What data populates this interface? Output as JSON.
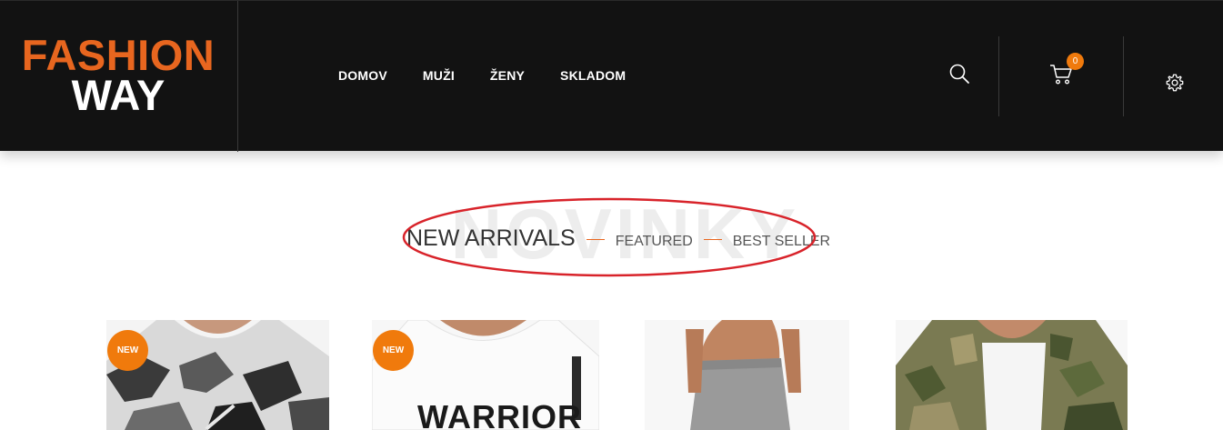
{
  "colors": {
    "accent": "#e8661f",
    "header_bg": "#121212",
    "annotation": "#d8232a",
    "badge": "#f07a0c"
  },
  "logo": {
    "line1": "FASHION",
    "line2": "WAY"
  },
  "nav": {
    "items": [
      "DOMOV",
      "MUŽI",
      "ŽENY",
      "SKLADOM"
    ]
  },
  "header_icons": {
    "search": "search-icon",
    "cart": "cart-icon",
    "settings": "gear-icon"
  },
  "cart": {
    "count": "0"
  },
  "section": {
    "ghost_title": "NOVINKY",
    "tabs": [
      {
        "label": "NEW ARRIVALS",
        "active": true
      },
      {
        "label": "FEATURED",
        "active": false
      },
      {
        "label": "BEST SELLER",
        "active": false
      }
    ]
  },
  "products": [
    {
      "badge": "NEW",
      "print": ""
    },
    {
      "badge": "NEW",
      "print": "WARRIOR"
    },
    {
      "badge": "",
      "print": ""
    },
    {
      "badge": "",
      "print": ""
    }
  ]
}
